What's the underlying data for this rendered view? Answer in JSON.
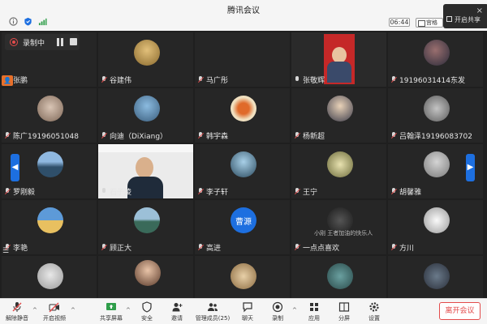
{
  "window": {
    "title": "腾讯会议"
  },
  "titlebar": {
    "timer": "06:44",
    "view_label": "宫格",
    "panel_label": "开启共享"
  },
  "recording": {
    "label": "录制中"
  },
  "grid": {
    "row1": [
      "张鹏",
      "谷建伟",
      "马广彤",
      "张敬辉",
      "19196031414东发"
    ],
    "row2": [
      "陈广19196051048",
      "向迪（DiXiang）",
      "韩宇森",
      "杨新超",
      "吕翰泽19196083702"
    ],
    "row3": [
      "罗刚毅",
      "石子凌",
      "李子轩",
      "王宁",
      "胡馨雅"
    ],
    "row4": [
      "李艳",
      "顾正大",
      "高进",
      "一点点喜欢",
      "方川"
    ],
    "row4_avatar_text": "曹源",
    "row4_overlay": "小刚 王者加油的快乐人"
  },
  "toolbar": {
    "mute": "解除静音",
    "video": "开启视频",
    "share": "共享屏幕",
    "security": "安全",
    "invite": "邀请",
    "members": "管理成员(25)",
    "chat": "聊天",
    "record": "录制",
    "apps": "应用",
    "settings": "设置",
    "layout": "分屏",
    "end": "离开会议"
  },
  "colors": {
    "accent": "#1d6fe0",
    "record": "#e34b4b",
    "highlight": "#2f9e4a"
  }
}
